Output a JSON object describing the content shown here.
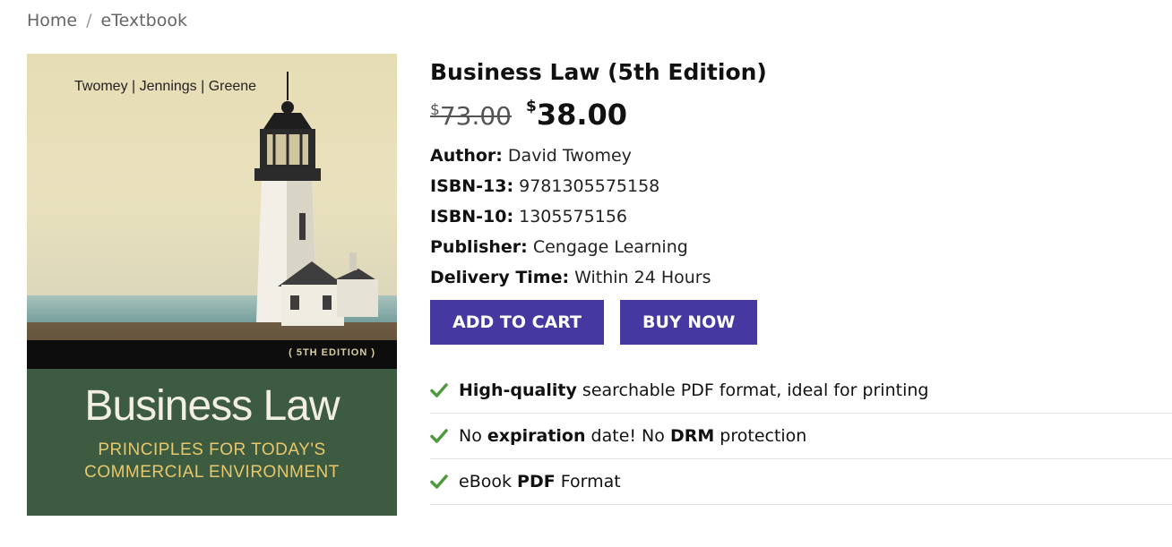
{
  "breadcrumb": {
    "home": "Home",
    "separator": "/",
    "current": "eTextbook"
  },
  "cover": {
    "authors": "Twomey | Jennings | Greene",
    "edition": "( 5TH EDITION )",
    "title": "Business Law",
    "subtitle_line1": "PRINCIPLES FOR TODAY'S",
    "subtitle_line2": "COMMERCIAL ENVIRONMENT"
  },
  "product": {
    "title": "Business Law (5th Edition)",
    "currency": "$",
    "old_price": "73.00",
    "new_price": "38.00",
    "details": [
      {
        "label": "Author:",
        "value": "David Twomey"
      },
      {
        "label": "ISBN-13:",
        "value": "9781305575158"
      },
      {
        "label": "ISBN-10:",
        "value": "1305575156"
      },
      {
        "label": "Publisher:",
        "value": "Cengage Learning"
      },
      {
        "label": "Delivery Time:",
        "value": "Within 24 Hours"
      }
    ],
    "add_to_cart": "ADD TO CART",
    "buy_now": "BUY NOW"
  },
  "features": [
    {
      "bold": "High-quality",
      "rest": " searchable PDF format, ideal for printing"
    },
    {
      "pre": "No ",
      "bold": "expiration",
      "mid": " date! No ",
      "bold2": "DRM",
      "rest": " protection"
    },
    {
      "pre": "eBook ",
      "bold": "PDF",
      "rest": " Format"
    }
  ],
  "colors": {
    "button": "#4538a0",
    "check": "#4f9a3f",
    "cover_green": "#3d5b41"
  },
  "icons": {
    "check": "check-icon"
  }
}
